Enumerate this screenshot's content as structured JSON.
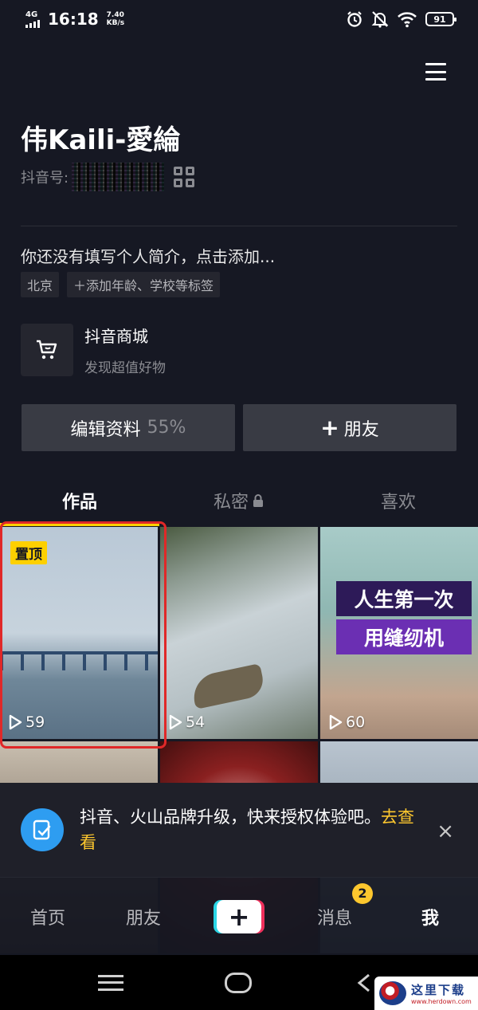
{
  "status_bar": {
    "network": "4G",
    "time": "16:18",
    "speed_value": "7.40",
    "speed_unit": "KB/s",
    "battery": "91"
  },
  "profile": {
    "username": "伟Kaili-愛綸",
    "douyin_id_label": "抖音号:",
    "bio_prompt": "你还没有填写个人简介，点击添加...",
    "tags": [
      "北京",
      "＋添加年龄、学校等标签"
    ]
  },
  "shop": {
    "title": "抖音商城",
    "subtitle": "发现超值好物"
  },
  "buttons": {
    "edit_label": "编辑资料",
    "edit_percent": "55%",
    "add_friend_label": "朋友"
  },
  "tabs": [
    {
      "label": "作品",
      "active": true
    },
    {
      "label": "私密",
      "locked": true
    },
    {
      "label": "喜欢"
    }
  ],
  "videos": [
    {
      "plays": "59",
      "pinned_label": "置顶"
    },
    {
      "plays": "54"
    },
    {
      "plays": "60",
      "overlay_lines": [
        "人生第一次",
        "用缝纫机"
      ]
    }
  ],
  "notice": {
    "text": "抖音、火山品牌升级，快来授权体验吧。",
    "link": "去查看",
    "close_symbol": "×"
  },
  "bottom_nav": {
    "items": [
      "首页",
      "朋友",
      "消息",
      "我"
    ],
    "messages_badge": "2",
    "plus_symbol": "+"
  },
  "watermark": {
    "name": "这里下载",
    "url": "www.herdown.com"
  },
  "colors": {
    "background": "#161823",
    "accent_yellow": "#fdd000",
    "selection_red": "#e02828",
    "button_gray": "#393b44"
  }
}
